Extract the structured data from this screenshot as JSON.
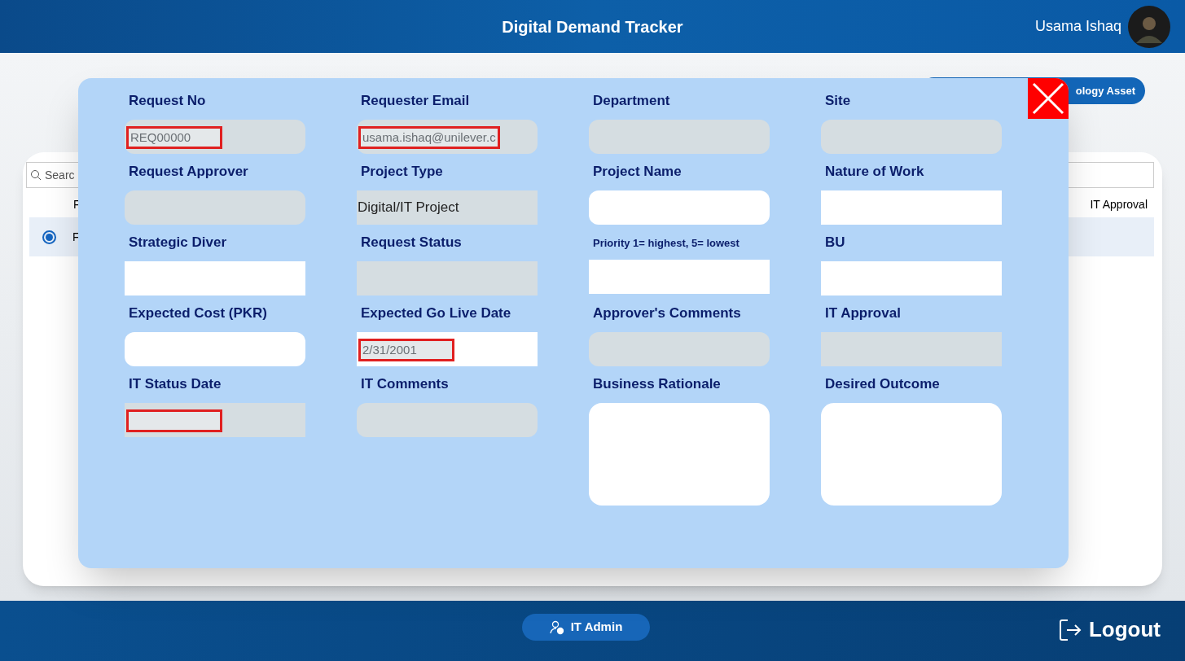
{
  "header": {
    "title": "Digital Demand Tracker",
    "user_name": "Usama Ishaq"
  },
  "background": {
    "button_2": "ology Asset",
    "search_placeholder": "Searc",
    "columns": [
      "F",
      "IT Approval"
    ],
    "row": {
      "selected": true,
      "cell": "F"
    }
  },
  "form": {
    "fields": [
      {
        "label": "Request No",
        "value": "REQ00000",
        "kind": "rounded",
        "disabled": true,
        "marked": true
      },
      {
        "label": "Requester Email",
        "value": "usama.ishaq@unilever.c",
        "kind": "rounded",
        "disabled": true,
        "marked": true
      },
      {
        "label": "Department",
        "kind": "rounded",
        "disabled": true,
        "marked": false
      },
      {
        "label": "Site",
        "kind": "rounded",
        "disabled": true,
        "marked": false
      },
      {
        "label": "Request Approver",
        "kind": "rounded",
        "disabled": true,
        "marked": false
      },
      {
        "label": "Project Type",
        "value": "Digital/IT Project",
        "kind": "square",
        "disabled": true,
        "marked": false
      },
      {
        "label": "Project Name",
        "kind": "rounded",
        "disabled": false,
        "marked": false
      },
      {
        "label": "Nature of Work",
        "kind": "square",
        "disabled": false,
        "marked": false
      },
      {
        "label": "Strategic Diver",
        "kind": "square",
        "disabled": false,
        "marked": false
      },
      {
        "label": "Request Status",
        "kind": "square",
        "disabled": true,
        "marked": false
      },
      {
        "label": "Priority 1= highest, 5= lowest",
        "small_label": true,
        "kind": "square",
        "disabled": false,
        "marked": false
      },
      {
        "label": "BU",
        "kind": "square",
        "disabled": false,
        "marked": false
      },
      {
        "label": "Expected Cost (PKR)",
        "kind": "rounded",
        "disabled": false,
        "marked": false
      },
      {
        "label": "Expected Go Live Date",
        "value": "2/31/2001",
        "kind": "square",
        "disabled": false,
        "marked": true
      },
      {
        "label": "Approver's Comments",
        "kind": "rounded",
        "disabled": true,
        "marked": false
      },
      {
        "label": "IT Approval",
        "kind": "square",
        "disabled": true,
        "marked": false
      },
      {
        "label": "IT Status Date",
        "kind": "square",
        "disabled": true,
        "marked": true
      },
      {
        "label": "IT Comments",
        "kind": "rounded",
        "disabled": true,
        "marked": false
      },
      {
        "label": "Business Rationale",
        "kind": "textarea",
        "disabled": false,
        "marked": false
      },
      {
        "label": "Desired Outcome",
        "kind": "textarea",
        "disabled": false,
        "marked": false
      }
    ]
  },
  "footer": {
    "admin_button": "IT Admin",
    "logout": "Logout"
  }
}
